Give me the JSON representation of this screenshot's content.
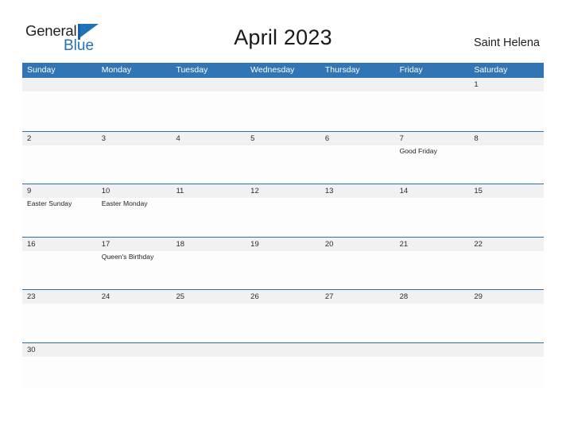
{
  "brand": {
    "name_part1": "General",
    "name_part2": "Blue",
    "flag_color": "#1f72b8",
    "text_color": "#231f20"
  },
  "header": {
    "title": "April 2023",
    "location": "Saint Helena"
  },
  "theme": {
    "header_blue": "#3275b4",
    "row_divider_blue": "#2f6fa8",
    "date_band_gray": "#f1f1f1",
    "cell_white": "#fdfdfd"
  },
  "calendar": {
    "day_names": [
      "Sunday",
      "Monday",
      "Tuesday",
      "Wednesday",
      "Thursday",
      "Friday",
      "Saturday"
    ],
    "weeks": [
      [
        {
          "date": "",
          "events": []
        },
        {
          "date": "",
          "events": []
        },
        {
          "date": "",
          "events": []
        },
        {
          "date": "",
          "events": []
        },
        {
          "date": "",
          "events": []
        },
        {
          "date": "",
          "events": []
        },
        {
          "date": "1",
          "events": []
        }
      ],
      [
        {
          "date": "2",
          "events": []
        },
        {
          "date": "3",
          "events": []
        },
        {
          "date": "4",
          "events": []
        },
        {
          "date": "5",
          "events": []
        },
        {
          "date": "6",
          "events": []
        },
        {
          "date": "7",
          "events": [
            "Good Friday"
          ]
        },
        {
          "date": "8",
          "events": []
        }
      ],
      [
        {
          "date": "9",
          "events": [
            "Easter Sunday"
          ]
        },
        {
          "date": "10",
          "events": [
            "Easter Monday"
          ]
        },
        {
          "date": "11",
          "events": []
        },
        {
          "date": "12",
          "events": []
        },
        {
          "date": "13",
          "events": []
        },
        {
          "date": "14",
          "events": []
        },
        {
          "date": "15",
          "events": []
        }
      ],
      [
        {
          "date": "16",
          "events": []
        },
        {
          "date": "17",
          "events": [
            "Queen's Birthday"
          ]
        },
        {
          "date": "18",
          "events": []
        },
        {
          "date": "19",
          "events": []
        },
        {
          "date": "20",
          "events": []
        },
        {
          "date": "21",
          "events": []
        },
        {
          "date": "22",
          "events": []
        }
      ],
      [
        {
          "date": "23",
          "events": []
        },
        {
          "date": "24",
          "events": []
        },
        {
          "date": "25",
          "events": []
        },
        {
          "date": "26",
          "events": []
        },
        {
          "date": "27",
          "events": []
        },
        {
          "date": "28",
          "events": []
        },
        {
          "date": "29",
          "events": []
        }
      ],
      [
        {
          "date": "30",
          "events": []
        },
        {
          "date": "",
          "events": []
        },
        {
          "date": "",
          "events": []
        },
        {
          "date": "",
          "events": []
        },
        {
          "date": "",
          "events": []
        },
        {
          "date": "",
          "events": []
        },
        {
          "date": "",
          "events": []
        }
      ]
    ]
  }
}
